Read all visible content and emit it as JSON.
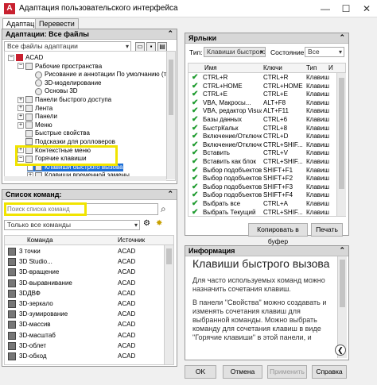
{
  "window": {
    "title": "Адаптация пользовательского интерфейса",
    "minimize": "—",
    "maximize": "☐",
    "close": "✕"
  },
  "tabs": [
    "Адаптация",
    "Перевести"
  ],
  "left_panel": {
    "header": "Адаптации: Все файлы",
    "combo": "Все файлы адаптации",
    "tree": [
      {
        "label": "ACAD",
        "toggle": "−",
        "icon": "red",
        "indent": 0
      },
      {
        "label": "Рабочие пространства",
        "toggle": "−",
        "icon": "box",
        "indent": 1
      },
      {
        "label": "Рисование и аннотации По умолчанию (текуща",
        "toggle": "",
        "icon": "gear",
        "indent": 2
      },
      {
        "label": "3D-моделирование",
        "toggle": "",
        "icon": "gear",
        "indent": 2
      },
      {
        "label": "Основы 3D",
        "toggle": "",
        "icon": "gear",
        "indent": 2
      },
      {
        "label": "Панели быстрого доступа",
        "toggle": "+",
        "icon": "box",
        "indent": 1
      },
      {
        "label": "Лента",
        "toggle": "+",
        "icon": "box",
        "indent": 1
      },
      {
        "label": "Панели",
        "toggle": "+",
        "icon": "box",
        "indent": 1
      },
      {
        "label": "Меню",
        "toggle": "+",
        "icon": "box",
        "indent": 1
      },
      {
        "label": "Быстрые свойства",
        "toggle": "",
        "icon": "box",
        "indent": 1
      },
      {
        "label": "Подсказки для ролловеров",
        "toggle": "",
        "icon": "box",
        "indent": 1
      },
      {
        "label": "Контекстные меню",
        "toggle": "+",
        "icon": "box",
        "indent": 1
      },
      {
        "label": "Горячие клавиши",
        "toggle": "−",
        "icon": "box",
        "indent": 1
      },
      {
        "label": "Клавиши быстрого вызова",
        "toggle": "+",
        "icon": "box",
        "indent": 2,
        "selected": true
      },
      {
        "label": "Клавиши временной замены",
        "toggle": "+",
        "icon": "box",
        "indent": 2
      }
    ]
  },
  "command_list": {
    "header": "Список команд:",
    "search_placeholder": "Поиск списка команд",
    "filter": "Только все команды",
    "col_command": "Команда",
    "col_source": "Источник",
    "rows": [
      {
        "name": "3 точки",
        "source": "ACAD"
      },
      {
        "name": "3D Studio...",
        "source": "ACAD"
      },
      {
        "name": "3D-вращение",
        "source": "ACAD"
      },
      {
        "name": "3D-выравнивание",
        "source": "ACAD"
      },
      {
        "name": "3DДВФ",
        "source": "ACAD"
      },
      {
        "name": "3D-зеркало",
        "source": "ACAD"
      },
      {
        "name": "3D-зумирование",
        "source": "ACAD"
      },
      {
        "name": "3D-массив",
        "source": "ACAD"
      },
      {
        "name": "3D-масштаб",
        "source": "ACAD"
      },
      {
        "name": "3D-облет",
        "source": "ACAD"
      },
      {
        "name": "3D-обход",
        "source": "ACAD"
      }
    ]
  },
  "shortcuts": {
    "header": "Ярлыки",
    "type_label": "Тип:",
    "type_value": "Клавиши быстрого вызо",
    "state_label": "Состояние:",
    "state_value": "Все",
    "col_name": "Имя",
    "col_keys": "Ключи",
    "col_type": "Тип",
    "col_extra": "И",
    "rows": [
      {
        "name": "CTRL+R",
        "keys": "CTRL+R",
        "type": "Клавиш"
      },
      {
        "name": "CTRL+HOME",
        "keys": "CTRL+HOME",
        "type": "Клавиш"
      },
      {
        "name": "CTRL+E",
        "keys": "CTRL+E",
        "type": "Клавиш"
      },
      {
        "name": "VBA, Макросы...",
        "keys": "ALT+F8",
        "type": "Клавиш"
      },
      {
        "name": "VBA, редактор Visual ...",
        "keys": "ALT+F11",
        "type": "Клавиш"
      },
      {
        "name": "Базы данных",
        "keys": "CTRL+6",
        "type": "Клавиш"
      },
      {
        "name": "БыстрКальк",
        "keys": "CTRL+8",
        "type": "Клавиш"
      },
      {
        "name": "Включение/Отключе...",
        "keys": "CTRL+D",
        "type": "Клавиш"
      },
      {
        "name": "Включение/Отключе...",
        "keys": "CTRL+SHIF...",
        "type": "Клавиш"
      },
      {
        "name": "Вставить",
        "keys": "CTRL+V",
        "type": "Клавиш"
      },
      {
        "name": "Вставить как блок",
        "keys": "CTRL+SHIF...",
        "type": "Клавиш"
      },
      {
        "name": "Выбор подобъектов...",
        "keys": "SHIFT+F1",
        "type": "Клавиш"
      },
      {
        "name": "Выбор подобъектов...",
        "keys": "SHIFT+F2",
        "type": "Клавиш"
      },
      {
        "name": "Выбор подобъектов...",
        "keys": "SHIFT+F3",
        "type": "Клавиш"
      },
      {
        "name": "Выбор подобъектов...",
        "keys": "SHIFT+F4",
        "type": "Клавиш"
      },
      {
        "name": "Выбрать все",
        "keys": "CTRL+A",
        "type": "Клавиш"
      },
      {
        "name": "Выбрать Текущий",
        "keys": "CTRL+SHIF...",
        "type": "Клавиш"
      }
    ],
    "copy_button": "Копировать в буфер",
    "print_button": "Печать"
  },
  "info": {
    "header": "Информация",
    "title": "Клавиши быстрого вызова",
    "para1": "Для часто используемых команд можно назначить сочетания клавиш.",
    "para2": "В панели \"Свойства\" можно создавать и изменять сочетания клавиш для выбранной команды. Можно выбрать команду для сочетания клавиш в виде \"Горячие клавиши\" в этой панели, и"
  },
  "footer": {
    "ok": "OK",
    "cancel": "Отмена",
    "apply": "Применить",
    "help": "Справка"
  },
  "colors": {
    "selection": "#1e6fd6",
    "highlight": "#f1e400",
    "check": "#1e9b2e",
    "brand": "#c8202f"
  }
}
